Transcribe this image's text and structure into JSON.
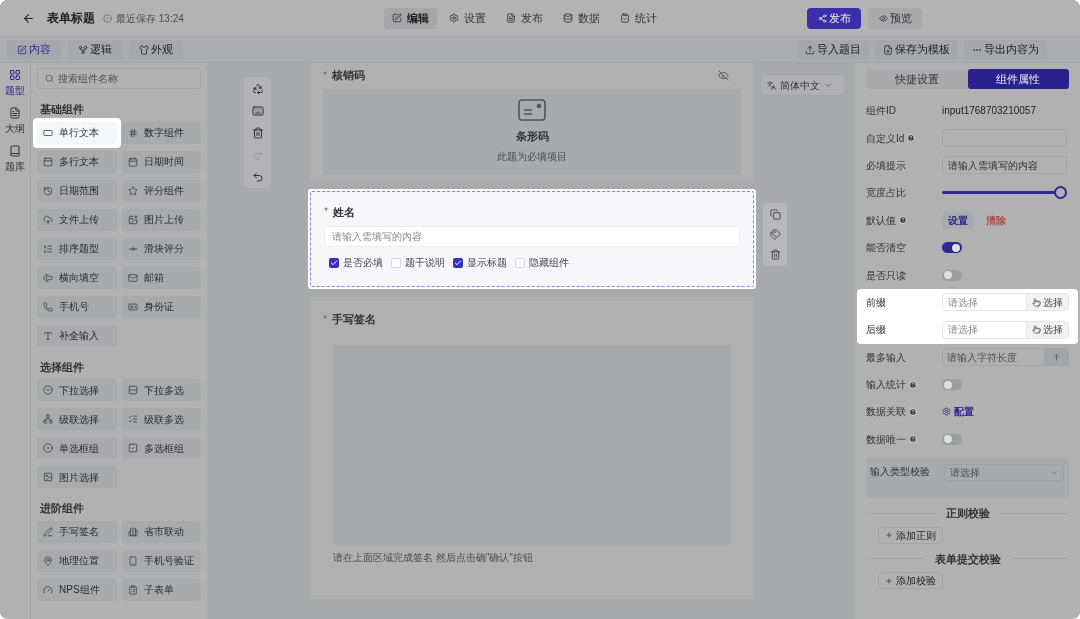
{
  "header": {
    "title": "表单标题",
    "saved": "最近保存 13:24"
  },
  "nav": [
    {
      "label": "编辑",
      "selected": true
    },
    {
      "label": "设置",
      "selected": false
    },
    {
      "label": "发布",
      "selected": false
    },
    {
      "label": "数据",
      "selected": false
    },
    {
      "label": "统计",
      "selected": false
    }
  ],
  "publish": "发布",
  "preview": "预览",
  "subtabs": [
    {
      "label": "内容",
      "selected": true
    },
    {
      "label": "逻辑",
      "selected": false
    },
    {
      "label": "外观",
      "selected": false
    }
  ],
  "actions": [
    "导入题目",
    "保存为模板",
    "导出内容为"
  ],
  "rail": [
    {
      "label": "题型",
      "selected": true
    },
    {
      "label": "大纲",
      "selected": false
    },
    {
      "label": "题库",
      "selected": false
    }
  ],
  "search": {
    "placeholder": "搜索组件名称"
  },
  "groups": [
    {
      "title": "基础组件",
      "items": [
        {
          "label": "单行文本",
          "highlighted": true
        },
        {
          "label": "数字组件",
          "highlighted": false
        },
        {
          "label": "多行文本",
          "highlighted": false
        },
        {
          "label": "日期时间",
          "highlighted": false
        },
        {
          "label": "日期范围",
          "highlighted": false
        },
        {
          "label": "评分组件",
          "highlighted": false
        },
        {
          "label": "文件上传",
          "highlighted": false
        },
        {
          "label": "图片上传",
          "highlighted": false
        },
        {
          "label": "排序题型",
          "highlighted": false
        },
        {
          "label": "滑块评分",
          "highlighted": false
        },
        {
          "label": "横向填空",
          "highlighted": false
        },
        {
          "label": "邮箱",
          "highlighted": false
        },
        {
          "label": "手机号",
          "highlighted": false
        },
        {
          "label": "身份证",
          "highlighted": false
        },
        {
          "label": "补全输入",
          "highlighted": false
        }
      ]
    },
    {
      "title": "选择组件",
      "items": [
        {
          "label": "下拉选择",
          "highlighted": false
        },
        {
          "label": "下拉多选",
          "highlighted": false
        },
        {
          "label": "级联选择",
          "highlighted": false
        },
        {
          "label": "级联多选",
          "highlighted": false
        },
        {
          "label": "单选框组",
          "highlighted": false
        },
        {
          "label": "多选框组",
          "highlighted": false
        },
        {
          "label": "图片选择",
          "highlighted": false
        }
      ]
    },
    {
      "title": "进阶组件",
      "items": [
        {
          "label": "手写签名",
          "highlighted": false
        },
        {
          "label": "省市联动",
          "highlighted": false
        },
        {
          "label": "地理位置",
          "highlighted": false
        },
        {
          "label": "手机号验证",
          "highlighted": false
        },
        {
          "label": "NPS组件",
          "highlighted": false
        },
        {
          "label": "子表单",
          "highlighted": false
        }
      ]
    }
  ],
  "language": "简体中文",
  "fields": [
    {
      "kind": "barcode",
      "title": "核销码",
      "mark": "*",
      "highlighted": false,
      "name": "条形码",
      "note": "此题为必填项目"
    },
    {
      "kind": "input",
      "title": "姓名",
      "mark": "*",
      "highlighted": true,
      "placeholder": "请输入需填写的内容",
      "options": [
        {
          "label": "是否必填",
          "checked": true
        },
        {
          "label": "题干说明",
          "checked": false
        },
        {
          "label": "显示标题",
          "checked": true
        },
        {
          "label": "隐藏组件",
          "checked": false
        }
      ]
    },
    {
      "kind": "signature",
      "title": "手写签名",
      "mark": "*",
      "highlighted": false,
      "hint": "请在上面区域完成签名 然后点击确\"确认\"按钮"
    }
  ],
  "panel_tabs": [
    {
      "label": "快捷设置",
      "selected": false
    },
    {
      "label": "组件属性",
      "selected": true
    }
  ],
  "props": [
    {
      "kind": "text",
      "label": "组件ID",
      "help": false,
      "highlighted": false,
      "value": "input1768703210057"
    },
    {
      "kind": "input",
      "label": "自定义Id",
      "help": true,
      "highlighted": false
    },
    {
      "kind": "input",
      "label": "必填提示",
      "help": false,
      "highlighted": false,
      "value": "请输入需填写的内容"
    },
    {
      "kind": "slider",
      "label": "宽度占比",
      "help": false,
      "highlighted": false,
      "level": 1
    },
    {
      "kind": "default",
      "label": "默认值",
      "help": true,
      "highlighted": false,
      "buttons": [
        "设置",
        "清除"
      ]
    },
    {
      "kind": "switch",
      "label": "能否清空",
      "help": false,
      "highlighted": false,
      "on": true
    },
    {
      "kind": "switch",
      "label": "是否只读",
      "help": false,
      "highlighted": false,
      "on": false
    },
    {
      "kind": "picker",
      "label": "前缀",
      "help": false,
      "highlighted": true,
      "placeholder": "请选择",
      "button": "选择"
    },
    {
      "kind": "picker",
      "label": "后缀",
      "help": false,
      "highlighted": true,
      "placeholder": "请选择",
      "button": "选择"
    },
    {
      "kind": "limit",
      "label": "最多输入",
      "help": false,
      "highlighted": false,
      "placeholder": "请输入字符长度"
    },
    {
      "kind": "switch",
      "label": "输入统计",
      "help": true,
      "highlighted": false,
      "on": false
    },
    {
      "kind": "link",
      "label": "数据关联",
      "help": true,
      "highlighted": false,
      "link": "配置"
    },
    {
      "kind": "switch",
      "label": "数据唯一",
      "help": true,
      "highlighted": false,
      "on": false
    }
  ],
  "type_check": {
    "label": "输入类型校验",
    "placeholder": "请选择"
  },
  "rules": [
    {
      "title": "正则校验",
      "button": "添加正则"
    },
    {
      "title": "表单提交校验",
      "button": "添加校验"
    }
  ]
}
